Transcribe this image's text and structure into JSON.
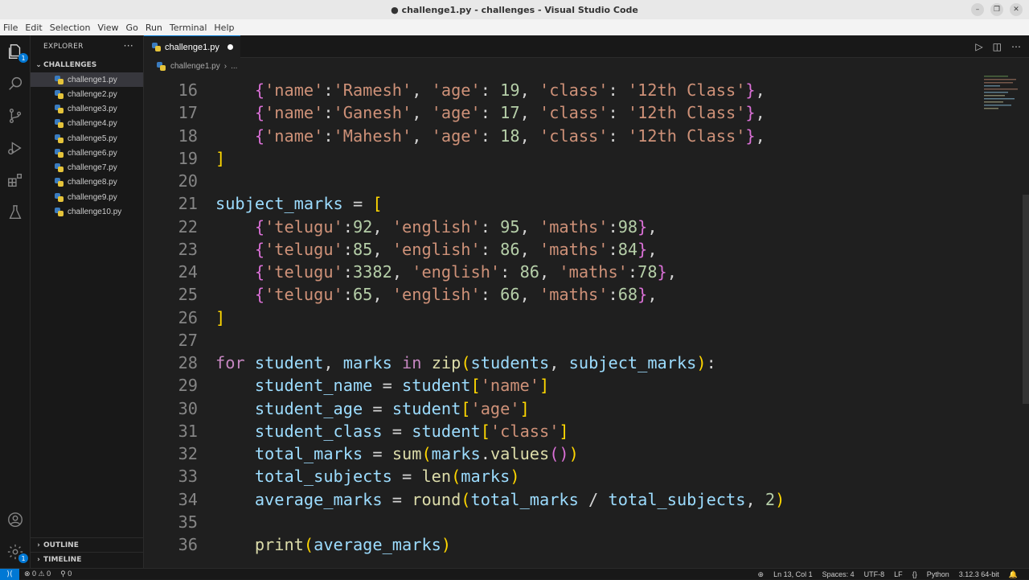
{
  "window": {
    "title": "● challenge1.py - challenges - Visual Studio Code"
  },
  "menu": [
    "File",
    "Edit",
    "Selection",
    "View",
    "Go",
    "Run",
    "Terminal",
    "Help"
  ],
  "activity": {
    "explorer_badge": "1",
    "settings_badge": "1"
  },
  "sidebar": {
    "header": "EXPLORER",
    "more": "···",
    "folder": "CHALLENGES",
    "files": [
      "challenge1.py",
      "challenge2.py",
      "challenge3.py",
      "challenge4.py",
      "challenge5.py",
      "challenge6.py",
      "challenge7.py",
      "challenge8.py",
      "challenge9.py",
      "challenge10.py"
    ],
    "outline": "OUTLINE",
    "timeline": "TIMELINE"
  },
  "tab": {
    "label": "challenge1.py"
  },
  "breadcrumb": {
    "file": "challenge1.py",
    "sep": "›",
    "more": "..."
  },
  "code": {
    "lines": [
      {
        "num": "16",
        "tokens": [
          [
            "p",
            "    "
          ],
          [
            "b2",
            "{"
          ],
          [
            "s",
            "'name'"
          ],
          [
            "p",
            ":"
          ],
          [
            "s",
            "'Ramesh'"
          ],
          [
            "p",
            ", "
          ],
          [
            "s",
            "'age'"
          ],
          [
            "p",
            ": "
          ],
          [
            "n",
            "19"
          ],
          [
            "p",
            ", "
          ],
          [
            "s",
            "'class'"
          ],
          [
            "p",
            ": "
          ],
          [
            "s",
            "'12th Class'"
          ],
          [
            "b2",
            "}"
          ],
          [
            "p",
            ","
          ]
        ]
      },
      {
        "num": "17",
        "tokens": [
          [
            "p",
            "    "
          ],
          [
            "b2",
            "{"
          ],
          [
            "s",
            "'name'"
          ],
          [
            "p",
            ":"
          ],
          [
            "s",
            "'Ganesh'"
          ],
          [
            "p",
            ", "
          ],
          [
            "s",
            "'age'"
          ],
          [
            "p",
            ": "
          ],
          [
            "n",
            "17"
          ],
          [
            "p",
            ", "
          ],
          [
            "s",
            "'class'"
          ],
          [
            "p",
            ": "
          ],
          [
            "s",
            "'12th Class'"
          ],
          [
            "b2",
            "}"
          ],
          [
            "p",
            ","
          ]
        ]
      },
      {
        "num": "18",
        "tokens": [
          [
            "p",
            "    "
          ],
          [
            "b2",
            "{"
          ],
          [
            "s",
            "'name'"
          ],
          [
            "p",
            ":"
          ],
          [
            "s",
            "'Mahesh'"
          ],
          [
            "p",
            ", "
          ],
          [
            "s",
            "'age'"
          ],
          [
            "p",
            ": "
          ],
          [
            "n",
            "18"
          ],
          [
            "p",
            ", "
          ],
          [
            "s",
            "'class'"
          ],
          [
            "p",
            ": "
          ],
          [
            "s",
            "'12th Class'"
          ],
          [
            "b2",
            "}"
          ],
          [
            "p",
            ","
          ]
        ]
      },
      {
        "num": "19",
        "tokens": [
          [
            "b1",
            "]"
          ]
        ]
      },
      {
        "num": "20",
        "tokens": []
      },
      {
        "num": "21",
        "tokens": [
          [
            "v",
            "subject_marks"
          ],
          [
            "p",
            " = "
          ],
          [
            "b1",
            "["
          ]
        ]
      },
      {
        "num": "22",
        "tokens": [
          [
            "p",
            "    "
          ],
          [
            "b2",
            "{"
          ],
          [
            "s",
            "'telugu'"
          ],
          [
            "p",
            ":"
          ],
          [
            "n",
            "92"
          ],
          [
            "p",
            ", "
          ],
          [
            "s",
            "'english'"
          ],
          [
            "p",
            ": "
          ],
          [
            "n",
            "95"
          ],
          [
            "p",
            ", "
          ],
          [
            "s",
            "'maths'"
          ],
          [
            "p",
            ":"
          ],
          [
            "n",
            "98"
          ],
          [
            "b2",
            "}"
          ],
          [
            "p",
            ","
          ]
        ]
      },
      {
        "num": "23",
        "tokens": [
          [
            "p",
            "    "
          ],
          [
            "b2",
            "{"
          ],
          [
            "s",
            "'telugu'"
          ],
          [
            "p",
            ":"
          ],
          [
            "n",
            "85"
          ],
          [
            "p",
            ", "
          ],
          [
            "s",
            "'english'"
          ],
          [
            "p",
            ": "
          ],
          [
            "n",
            "86"
          ],
          [
            "p",
            ", "
          ],
          [
            "s",
            "'maths'"
          ],
          [
            "p",
            ":"
          ],
          [
            "n",
            "84"
          ],
          [
            "b2",
            "}"
          ],
          [
            "p",
            ","
          ]
        ]
      },
      {
        "num": "24",
        "tokens": [
          [
            "p",
            "    "
          ],
          [
            "b2",
            "{"
          ],
          [
            "s",
            "'telugu'"
          ],
          [
            "p",
            ":"
          ],
          [
            "n",
            "3382"
          ],
          [
            "p",
            ", "
          ],
          [
            "s",
            "'english'"
          ],
          [
            "p",
            ": "
          ],
          [
            "n",
            "86"
          ],
          [
            "p",
            ", "
          ],
          [
            "s",
            "'maths'"
          ],
          [
            "p",
            ":"
          ],
          [
            "n",
            "78"
          ],
          [
            "b2",
            "}"
          ],
          [
            "p",
            ","
          ]
        ]
      },
      {
        "num": "25",
        "tokens": [
          [
            "p",
            "    "
          ],
          [
            "b2",
            "{"
          ],
          [
            "s",
            "'telugu'"
          ],
          [
            "p",
            ":"
          ],
          [
            "n",
            "65"
          ],
          [
            "p",
            ", "
          ],
          [
            "s",
            "'english'"
          ],
          [
            "p",
            ": "
          ],
          [
            "n",
            "66"
          ],
          [
            "p",
            ", "
          ],
          [
            "s",
            "'maths'"
          ],
          [
            "p",
            ":"
          ],
          [
            "n",
            "68"
          ],
          [
            "b2",
            "}"
          ],
          [
            "p",
            ","
          ]
        ]
      },
      {
        "num": "26",
        "tokens": [
          [
            "b1",
            "]"
          ]
        ]
      },
      {
        "num": "27",
        "tokens": []
      },
      {
        "num": "28",
        "tokens": [
          [
            "kc",
            "for"
          ],
          [
            "p",
            " "
          ],
          [
            "v",
            "student"
          ],
          [
            "p",
            ", "
          ],
          [
            "v",
            "marks"
          ],
          [
            "p",
            " "
          ],
          [
            "kc",
            "in"
          ],
          [
            "p",
            " "
          ],
          [
            "f",
            "zip"
          ],
          [
            "b1",
            "("
          ],
          [
            "v",
            "students"
          ],
          [
            "p",
            ", "
          ],
          [
            "v",
            "subject_marks"
          ],
          [
            "b1",
            ")"
          ],
          [
            "p",
            ":"
          ]
        ]
      },
      {
        "num": "29",
        "tokens": [
          [
            "p",
            "    "
          ],
          [
            "v",
            "student_name"
          ],
          [
            "p",
            " = "
          ],
          [
            "v",
            "student"
          ],
          [
            "b1",
            "["
          ],
          [
            "s",
            "'name'"
          ],
          [
            "b1",
            "]"
          ]
        ]
      },
      {
        "num": "30",
        "tokens": [
          [
            "p",
            "    "
          ],
          [
            "v",
            "student_age"
          ],
          [
            "p",
            " = "
          ],
          [
            "v",
            "student"
          ],
          [
            "b1",
            "["
          ],
          [
            "s",
            "'age'"
          ],
          [
            "b1",
            "]"
          ]
        ]
      },
      {
        "num": "31",
        "tokens": [
          [
            "p",
            "    "
          ],
          [
            "v",
            "student_class"
          ],
          [
            "p",
            " = "
          ],
          [
            "v",
            "student"
          ],
          [
            "b1",
            "["
          ],
          [
            "s",
            "'class'"
          ],
          [
            "b1",
            "]"
          ]
        ]
      },
      {
        "num": "32",
        "tokens": [
          [
            "p",
            "    "
          ],
          [
            "v",
            "total_marks"
          ],
          [
            "p",
            " = "
          ],
          [
            "f",
            "sum"
          ],
          [
            "b1",
            "("
          ],
          [
            "v",
            "marks"
          ],
          [
            "p",
            "."
          ],
          [
            "f",
            "values"
          ],
          [
            "b2",
            "()"
          ],
          [
            "b1",
            ")"
          ]
        ]
      },
      {
        "num": "33",
        "tokens": [
          [
            "p",
            "    "
          ],
          [
            "v",
            "total_subjects"
          ],
          [
            "p",
            " = "
          ],
          [
            "f",
            "len"
          ],
          [
            "b1",
            "("
          ],
          [
            "v",
            "marks"
          ],
          [
            "b1",
            ")"
          ]
        ]
      },
      {
        "num": "34",
        "tokens": [
          [
            "p",
            "    "
          ],
          [
            "v",
            "average_marks"
          ],
          [
            "p",
            " = "
          ],
          [
            "f",
            "round"
          ],
          [
            "b1",
            "("
          ],
          [
            "v",
            "total_marks"
          ],
          [
            "p",
            " / "
          ],
          [
            "v",
            "total_subjects"
          ],
          [
            "p",
            ", "
          ],
          [
            "n",
            "2"
          ],
          [
            "b1",
            ")"
          ]
        ]
      },
      {
        "num": "35",
        "tokens": []
      },
      {
        "num": "36",
        "tokens": [
          [
            "p",
            "    "
          ],
          [
            "f",
            "print"
          ],
          [
            "b1",
            "("
          ],
          [
            "v",
            "average_marks"
          ],
          [
            "b1",
            ")"
          ]
        ]
      }
    ]
  },
  "status": {
    "errors": "⊗ 0 ⚠ 0",
    "ports": "⚲ 0",
    "position": "Ln 13, Col 1",
    "spaces": "Spaces: 4",
    "encoding": "UTF-8",
    "eol": "LF",
    "language_braces": "{}",
    "language": "Python",
    "interpreter": "3.12.3 64-bit"
  }
}
